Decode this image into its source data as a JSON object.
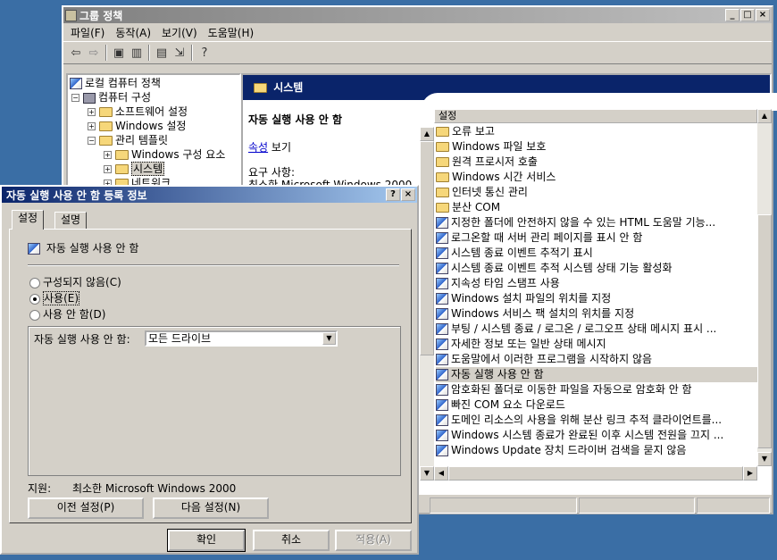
{
  "main_window": {
    "title": "그룹 정책",
    "controls": [
      "_",
      "□",
      "×"
    ],
    "menu": [
      "파일(F)",
      "동작(A)",
      "보기(V)",
      "도움말(H)"
    ],
    "toolbar_icons": [
      "back-arrow-icon",
      "forward-arrow-icon",
      "up-folder-icon",
      "show-hide-tree-icon",
      "properties-icon",
      "export-list-icon",
      "help-icon"
    ]
  },
  "tree": {
    "root": "로컬 컴퓨터 정책",
    "computer_config": "컴퓨터 구성",
    "software_settings": "소프트웨어 설정",
    "windows_settings": "Windows 설정",
    "admin_templates": "관리 템플릿",
    "windows_components": "Windows 구성 요소",
    "system": "시스템",
    "network": "네트워크"
  },
  "detail": {
    "header_title": "시스템",
    "policy_title": "자동 실행 사용 안 함",
    "properties_link": "속성",
    "properties_suffix": " 보기",
    "requirements_label": "요구 사항:",
    "requirements_value": "최소한 Microsoft Windows 2000"
  },
  "list": {
    "column_header": "설정",
    "items": [
      {
        "label": "오류 보고",
        "type": "folder"
      },
      {
        "label": "Windows 파일 보호",
        "type": "folder"
      },
      {
        "label": "원격 프로시저 호출",
        "type": "folder"
      },
      {
        "label": "Windows 시간 서비스",
        "type": "folder"
      },
      {
        "label": "인터넷 통신 관리",
        "type": "folder"
      },
      {
        "label": "분산 COM",
        "type": "folder"
      },
      {
        "label": "지정한 폴더에 안전하지 않을 수 있는 HTML 도움말 기능...",
        "type": "policy"
      },
      {
        "label": "로그온할 때 서버 관리 페이지를 표시 안 함",
        "type": "policy"
      },
      {
        "label": "시스템 종료 이벤트 추적기 표시",
        "type": "policy"
      },
      {
        "label": "시스템 종료 이벤트 추적 시스템 상태 기능 활성화",
        "type": "policy"
      },
      {
        "label": "지속성 타임 스탬프 사용",
        "type": "policy"
      },
      {
        "label": "Windows 설치 파일의 위치를 지정",
        "type": "policy"
      },
      {
        "label": "Windows 서비스 팩 설치의 위치를 지정",
        "type": "policy"
      },
      {
        "label": "부팅 / 시스템 종료 / 로그온 / 로그오프 상태 메시지 표시 ...",
        "type": "policy"
      },
      {
        "label": "자세한 정보 또는 일반 상태 메시지",
        "type": "policy"
      },
      {
        "label": "도움말에서 이러한 프로그램을 시작하지 않음",
        "type": "policy"
      },
      {
        "label": "자동 실행 사용 안 함",
        "type": "policy",
        "selected": true
      },
      {
        "label": "암호화된 폴더로 이동한 파일을 자동으로 암호화 안 함",
        "type": "policy"
      },
      {
        "label": "빠진 COM 요소 다운로드",
        "type": "policy"
      },
      {
        "label": "도메인 리소스의 사용을 위해 분산 링크 추적 클라이언트를...",
        "type": "policy"
      },
      {
        "label": "Windows 시스템 종료가 완료된 이후 시스템 전원을 끄지 ...",
        "type": "policy"
      },
      {
        "label": "Windows Update 장치 드라이버 검색을 묻지 않음",
        "type": "policy"
      }
    ]
  },
  "dialog": {
    "title": "자동 실행 사용 안 함 등록 정보",
    "controls": [
      "?",
      "×"
    ],
    "tabs": [
      "설정",
      "설명"
    ],
    "policy_name": "자동 실행 사용 안 함",
    "radio_not_configured": "구성되지 않음(C)",
    "radio_enabled": "사용(E)",
    "radio_disabled": "사용 안 함(D)",
    "selected_option": "사용(E)",
    "option_label": "자동 실행 사용 안 함:",
    "option_value": "모든 드라이브",
    "supported_label": "지원:",
    "supported_value": "최소한 Microsoft Windows 2000",
    "prev_button": "이전 설정(P)",
    "next_button": "다음 설정(N)",
    "ok_button": "확인",
    "cancel_button": "취소",
    "apply_button": "적용(A)"
  }
}
